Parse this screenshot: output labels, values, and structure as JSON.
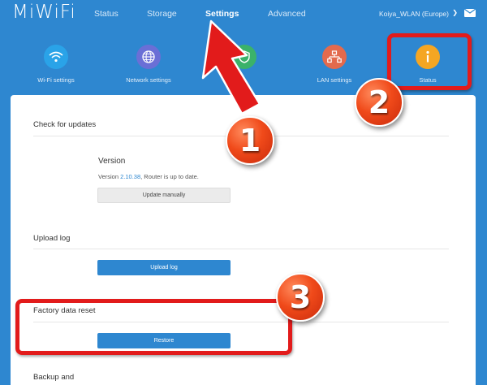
{
  "header": {
    "logo": "MiWiFi",
    "nav": [
      "Status",
      "Storage",
      "Settings",
      "Advanced"
    ],
    "network_name": "Koiya_WLAN (Europe)"
  },
  "tiles": [
    {
      "label": "Wi-Fi settings",
      "icon": "wifi-icon",
      "color": "#2aa3e8"
    },
    {
      "label": "Network settings",
      "icon": "globe-icon",
      "color": "#6a6fd6"
    },
    {
      "label": "",
      "icon": "shield-icon",
      "color": "#3bb26a"
    },
    {
      "label": "LAN settings",
      "icon": "lan-icon",
      "color": "#e36a4d"
    },
    {
      "label": "Status",
      "icon": "info-icon",
      "color": "#f5a623"
    }
  ],
  "sections": {
    "updates": {
      "title": "Check for updates",
      "heading": "Version",
      "version_prefix": "Version ",
      "version_number": "2.10.38",
      "version_suffix": ", Router is up to date.",
      "button": "Update manually"
    },
    "log": {
      "title": "Upload log",
      "button": "Upload log"
    },
    "reset": {
      "title": "Factory data reset",
      "button": "Restore"
    },
    "backup": {
      "title": "Backup and"
    }
  },
  "markers": [
    "1",
    "2",
    "3"
  ],
  "colors": {
    "accent": "#2e87d0",
    "highlight": "#e21b1b",
    "marker": "#f04a1a"
  }
}
